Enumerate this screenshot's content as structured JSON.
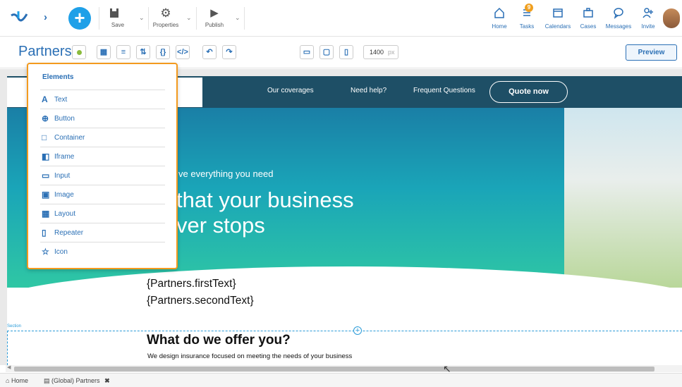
{
  "toolbar": {
    "save_label": "Save",
    "properties_label": "Properties",
    "publish_label": "Publish"
  },
  "topnav": {
    "home": "Home",
    "tasks": "Tasks",
    "tasks_badge": "9",
    "calendars": "Calendars",
    "cases": "Cases",
    "messages": "Messages",
    "invite": "Invite"
  },
  "designer": {
    "title": "Partners",
    "width_value": "1400",
    "width_unit": "px",
    "preview_label": "Preview"
  },
  "elements_menu": {
    "title": "Elements",
    "items": [
      {
        "label": "Text",
        "icon": "text-icon"
      },
      {
        "label": "Button",
        "icon": "button-icon"
      },
      {
        "label": "Container",
        "icon": "container-icon"
      },
      {
        "label": "Iframe",
        "icon": "iframe-icon"
      },
      {
        "label": "Input",
        "icon": "input-icon"
      },
      {
        "label": "Image",
        "icon": "image-icon"
      },
      {
        "label": "Layout",
        "icon": "layout-icon"
      },
      {
        "label": "Repeater",
        "icon": "repeater-icon"
      },
      {
        "label": "Icon",
        "icon": "star-icon"
      }
    ]
  },
  "site": {
    "nav": [
      "Our coverages",
      "Need help?",
      "Frequent Questions"
    ],
    "quote_label": "Quote now",
    "hero_small": "ve everything you need",
    "hero_line1": "that your business",
    "hero_line2": "ver stops",
    "field1": "{Partners.firstText}",
    "field2": "{Partners.secondText}",
    "section_label": "Section",
    "offer_title": "What do we offer you?",
    "offer_sub": "We design insurance focused on meeting the needs of your business"
  },
  "bottom_tabs": {
    "home": "Home",
    "page": "(Global) Partners"
  },
  "colors": {
    "accent": "#2a6fb5",
    "popup_border": "#f39a1e",
    "hero_top": "#1a7fa6",
    "hero_bottom": "#2fc7a4"
  }
}
